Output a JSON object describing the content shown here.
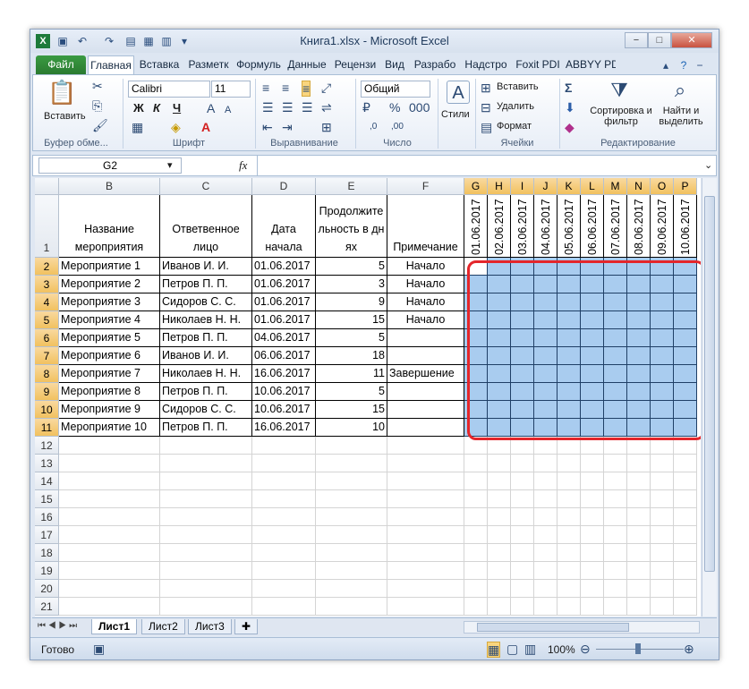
{
  "window": {
    "title": "Книга1.xlsx - Microsoft Excel",
    "minimize": "−",
    "restore": "□",
    "close": "✕"
  },
  "tabs": [
    "Файл",
    "Главная",
    "Вставка",
    "Разметк",
    "Формуль",
    "Данные",
    "Рецензи",
    "Вид",
    "Разрабо",
    "Надстро",
    "Foxit PDI",
    "ABBYY PD"
  ],
  "ribbon": {
    "clipboard": {
      "paste": "Вставить",
      "label": "Буфер обме..."
    },
    "font": {
      "name": "Calibri",
      "size": "11",
      "bold": "Ж",
      "italic": "К",
      "underline": "Ч",
      "label": "Шрифт"
    },
    "alignment": {
      "label": "Выравнивание"
    },
    "number": {
      "format": "Общий",
      "label": "Число"
    },
    "styles": {
      "label": "Стили"
    },
    "cells": {
      "insert": "Вставить",
      "delete": "Удалить",
      "format": "Формат",
      "label": "Ячейки"
    },
    "editing": {
      "sort_filter": "Сортировка и фильтр",
      "find_select": "Найти и выделить",
      "label": "Редактирование"
    }
  },
  "formula_bar": {
    "name_box": "G2",
    "fx": "fx",
    "value": ""
  },
  "columns": [
    "B",
    "C",
    "D",
    "E",
    "F",
    "G",
    "H",
    "I",
    "J",
    "K",
    "L",
    "M",
    "N",
    "O",
    "P"
  ],
  "header_row": {
    "b": "Название мероприятия",
    "c": "Ответвенное лицо",
    "d": "Дата начала",
    "e": "Продолжительность в днях",
    "f": "Примечание"
  },
  "date_headers": [
    "01.06.2017",
    "02.06.2017",
    "03.06.2017",
    "04.06.2017",
    "05.06.2017",
    "06.06.2017",
    "07.06.2017",
    "08.06.2017",
    "09.06.2017",
    "10.06.2017"
  ],
  "rows": [
    {
      "b": "Мероприятие 1",
      "c": "Иванов И. И.",
      "d": "01.06.2017",
      "e": "5",
      "f": "Начало"
    },
    {
      "b": "Мероприятие 2",
      "c": "Петров П. П.",
      "d": "01.06.2017",
      "e": "3",
      "f": "Начало"
    },
    {
      "b": "Мероприятие 3",
      "c": "Сидоров С. С.",
      "d": "01.06.2017",
      "e": "9",
      "f": "Начало"
    },
    {
      "b": "Мероприятие 4",
      "c": "Николаев Н. Н.",
      "d": "01.06.2017",
      "e": "15",
      "f": "Начало"
    },
    {
      "b": "Мероприятие 5",
      "c": "Петров П. П.",
      "d": "04.06.2017",
      "e": "5",
      "f": ""
    },
    {
      "b": "Мероприятие 6",
      "c": "Иванов И. И.",
      "d": "06.06.2017",
      "e": "18",
      "f": ""
    },
    {
      "b": "Мероприятие 7",
      "c": "Николаев Н. Н.",
      "d": "16.06.2017",
      "e": "11",
      "f": "Завершение"
    },
    {
      "b": "Мероприятие 8",
      "c": "Петров П. П.",
      "d": "10.06.2017",
      "e": "5",
      "f": ""
    },
    {
      "b": "Мероприятие 9",
      "c": "Сидоров С. С.",
      "d": "10.06.2017",
      "e": "15",
      "f": ""
    },
    {
      "b": "Мероприятие 10",
      "c": "Петров П. П.",
      "d": "16.06.2017",
      "e": "10",
      "f": ""
    }
  ],
  "row_numbers": [
    "1",
    "2",
    "3",
    "4",
    "5",
    "6",
    "7",
    "8",
    "9",
    "10",
    "11",
    "12",
    "13",
    "14",
    "15",
    "16",
    "17",
    "18",
    "19",
    "20",
    "21"
  ],
  "sheets": [
    "Лист1",
    "Лист2",
    "Лист3"
  ],
  "status": {
    "ready": "Готово",
    "zoom": "100%"
  }
}
